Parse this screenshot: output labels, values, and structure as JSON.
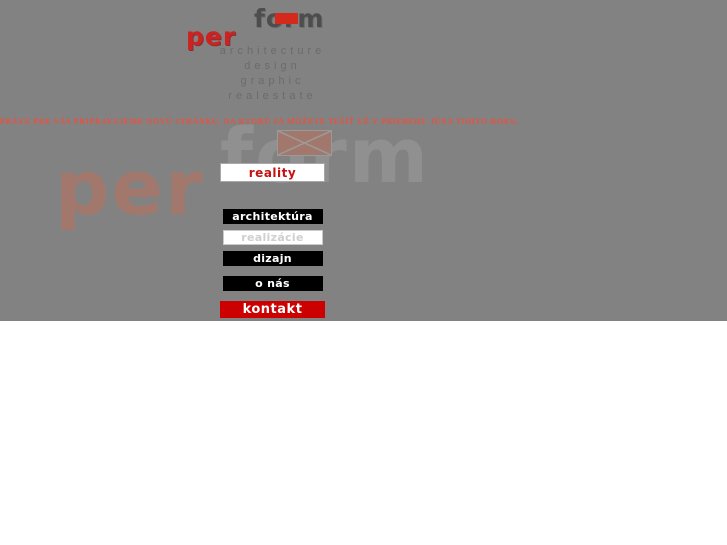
{
  "colors": {
    "page_background": "#828282",
    "logo_red": "#cc2222",
    "logo_gray": "#4d4d4d",
    "notice_red": "#e8513f",
    "watermark_red": "#a3786c",
    "watermark_gray": "#909090",
    "button_black": "#000000",
    "kontakt_red": "#cc0000",
    "reality_red": "#c41212"
  },
  "logo": {
    "word_top": "form",
    "word_bottom": "per",
    "o_box": "logo-o-block"
  },
  "tagline": {
    "lines": [
      "architecture",
      "design",
      "graphic",
      "realestate"
    ]
  },
  "notice": {
    "text": "PRÁVE PRE VÁS PRIPRAVUJEME NOVÚ STRÁNKU, NA KTORÚ SA MÔŽETE TEŠIŤ UŽ V PRIEBEHU JÚNA TOHTO ROKU."
  },
  "watermark": {
    "word_top": "form",
    "word_bottom": "per",
    "broken_image": "broken-image-icon"
  },
  "reality_button": {
    "label": "reality"
  },
  "nav": {
    "items": [
      {
        "label": "architektúra",
        "state": "normal"
      },
      {
        "label": "realizácie",
        "state": "hover"
      },
      {
        "label": "dizajn",
        "state": "normal"
      },
      {
        "label": "o nás",
        "state": "normal"
      },
      {
        "label": "kontakt",
        "state": "highlight"
      }
    ]
  }
}
